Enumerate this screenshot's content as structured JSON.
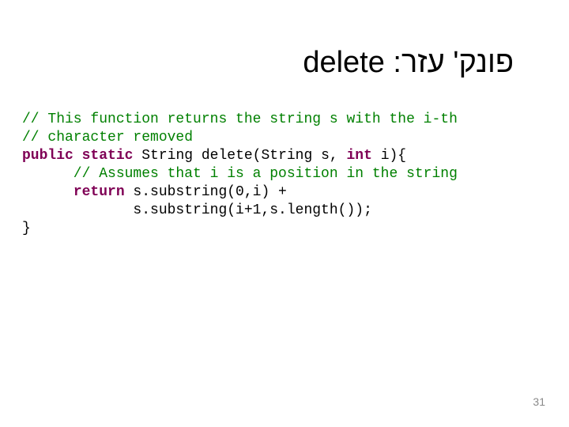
{
  "title": {
    "hebrew_prefix": "פונק' עזר: ",
    "latin": "delete"
  },
  "code": {
    "c1": "// This function returns the string s with the i-th",
    "c2": "// character removed",
    "kw_public": "public",
    "kw_static": "static",
    "type_string": "String",
    "sig_rest": " delete(String s, ",
    "kw_int": "int",
    "sig_tail": " i){",
    "c3": "      // Assumes that i is a position in the string",
    "indent_return": "      ",
    "kw_return": "return",
    "ret_rest": " s.substring(0,i) +",
    "line_concat": "             s.substring(i+1,s.length());",
    "close": "}"
  },
  "page_number": "31"
}
